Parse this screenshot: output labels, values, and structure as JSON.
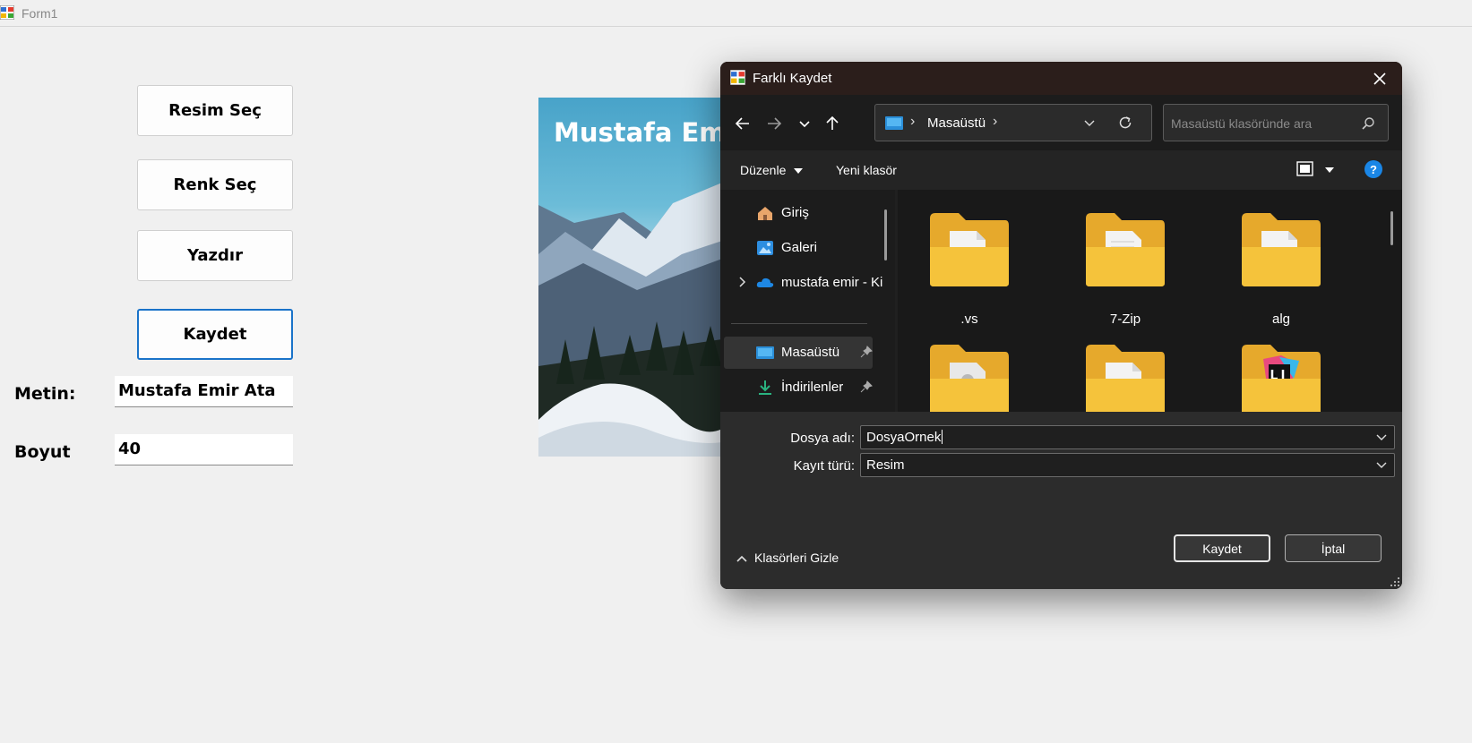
{
  "window": {
    "title": "Form1"
  },
  "form": {
    "buttons": {
      "choose_image": "Resim Seç",
      "choose_color": "Renk Seç",
      "print": "Yazdır",
      "save": "Kaydet"
    },
    "text_label": "Metin:",
    "text_value": "Mustafa Emir Ata",
    "size_label": "Boyut",
    "size_value": "40",
    "picture_text": "Mustafa Emir"
  },
  "dialog": {
    "title": "Farklı Kaydet",
    "address": {
      "crumb": "Masaüstü",
      "separator": "›"
    },
    "search_placeholder": "Masaüstü klasöründe ara",
    "command_bar": {
      "organize": "Düzenle",
      "new_folder": "Yeni klasör",
      "help": "?"
    },
    "nav_items": [
      {
        "label": "Giriş",
        "icon": "home-icon"
      },
      {
        "label": "Galeri",
        "icon": "gallery-icon"
      },
      {
        "label": "mustafa emir - Ki",
        "icon": "onedrive-cloud-icon"
      },
      {
        "label": "Masaüstü",
        "icon": "desktop-icon"
      },
      {
        "label": "İndirilenler",
        "icon": "download-icon"
      }
    ],
    "folders": [
      ".vs",
      "7-Zip",
      "alg",
      "",
      "",
      ""
    ],
    "file_name_label": "Dosya adı:",
    "file_name_value": "DosyaOrnek",
    "file_type_label": "Kayıt türü:",
    "file_type_value": "Resim",
    "hide_folders": "Klasörleri Gizle",
    "save_button": "Kaydet",
    "cancel_button": "İptal"
  },
  "colors": {
    "form_background": "#f0f0f0",
    "focus_blue": "#1a73c9",
    "dialog_background": "#202020",
    "dialog_titlebar": "#2b1e1b",
    "folder_yellow": "#f5c33b",
    "help_blue": "#1a86e6"
  }
}
